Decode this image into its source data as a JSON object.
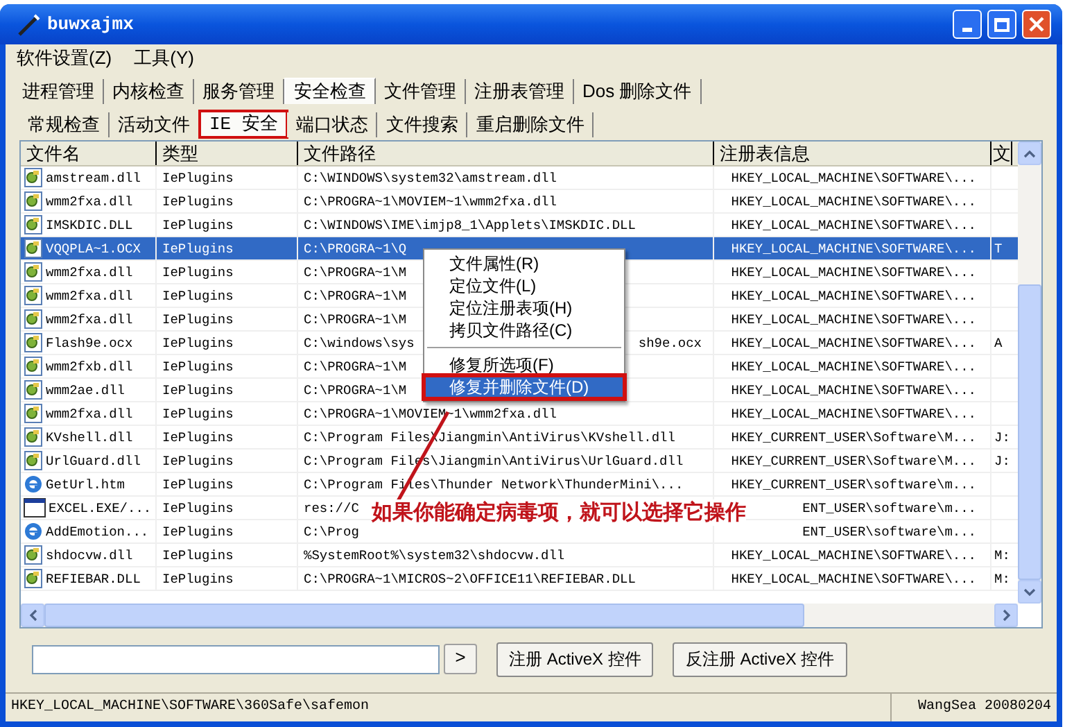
{
  "window": {
    "title": "buwxajmx"
  },
  "menu": [
    "软件设置(Z)",
    "工具(Y)"
  ],
  "tabs": [
    {
      "label": "进程管理",
      "selected": false
    },
    {
      "label": "内核检查",
      "selected": false
    },
    {
      "label": "服务管理",
      "selected": false
    },
    {
      "label": "安全检查",
      "selected": true
    },
    {
      "label": "文件管理",
      "selected": false
    },
    {
      "label": "注册表管理",
      "selected": false
    },
    {
      "label": "Dos 删除文件",
      "selected": false
    }
  ],
  "subtabs": [
    {
      "label": "常规检查",
      "selected": false,
      "highlighted": false
    },
    {
      "label": "活动文件",
      "selected": false,
      "highlighted": false
    },
    {
      "label": "IE 安全",
      "selected": true,
      "highlighted": true
    },
    {
      "label": "端口状态",
      "selected": false,
      "highlighted": false
    },
    {
      "label": "文件搜索",
      "selected": false,
      "highlighted": false
    },
    {
      "label": "重启删除文件",
      "selected": false,
      "highlighted": false
    }
  ],
  "table": {
    "columns": [
      "文件名",
      "类型",
      "文件路径",
      "注册表信息",
      "文"
    ],
    "rows": [
      {
        "kind": "dll",
        "selected": false,
        "name": "amstream.dll",
        "type": "IePlugins",
        "path": "C:\\WINDOWS\\system32\\amstream.dll",
        "registry": "HKEY_LOCAL_MACHINE\\SOFTWARE\\..."
      },
      {
        "kind": "dll",
        "selected": false,
        "name": "wmm2fxa.dll",
        "type": "IePlugins",
        "path": "C:\\PROGRA~1\\MOVIEM~1\\wmm2fxa.dll",
        "registry": "HKEY_LOCAL_MACHINE\\SOFTWARE\\..."
      },
      {
        "kind": "dll",
        "selected": false,
        "name": "IMSKDIC.DLL",
        "type": "IePlugins",
        "path": "C:\\WINDOWS\\IME\\imjp8_1\\Applets\\IMSKDIC.DLL",
        "registry": "HKEY_LOCAL_MACHINE\\SOFTWARE\\..."
      },
      {
        "kind": "dll",
        "selected": true,
        "name": "VQQPLA~1.OCX",
        "type": "IePlugins",
        "path": "C:\\PROGRA~1\\Q",
        "registry": "HKEY_LOCAL_MACHINE\\SOFTWARE\\...",
        "extra": "T"
      },
      {
        "kind": "dll",
        "selected": false,
        "name": "wmm2fxa.dll",
        "type": "IePlugins",
        "path": "C:\\PROGRA~1\\M",
        "registry": "HKEY_LOCAL_MACHINE\\SOFTWARE\\..."
      },
      {
        "kind": "dll",
        "selected": false,
        "name": "wmm2fxa.dll",
        "type": "IePlugins",
        "path": "C:\\PROGRA~1\\M",
        "registry": "HKEY_LOCAL_MACHINE\\SOFTWARE\\..."
      },
      {
        "kind": "dll",
        "selected": false,
        "name": "wmm2fxa.dll",
        "type": "IePlugins",
        "path": "C:\\PROGRA~1\\M",
        "registry": "HKEY_LOCAL_MACHINE\\SOFTWARE\\..."
      },
      {
        "kind": "dll",
        "selected": false,
        "name": "Flash9e.ocx",
        "type": "IePlugins",
        "path": "C:\\windows\\sys",
        "path_tail": "sh9e.ocx",
        "registry": "HKEY_LOCAL_MACHINE\\SOFTWARE\\...",
        "extra": "A"
      },
      {
        "kind": "dll",
        "selected": false,
        "name": "wmm2fxb.dll",
        "type": "IePlugins",
        "path": "C:\\PROGRA~1\\M",
        "registry": "HKEY_LOCAL_MACHINE\\SOFTWARE\\..."
      },
      {
        "kind": "dll",
        "selected": false,
        "name": "wmm2ae.dll",
        "type": "IePlugins",
        "path": "C:\\PROGRA~1\\M",
        "registry": "HKEY_LOCAL_MACHINE\\SOFTWARE\\..."
      },
      {
        "kind": "dll",
        "selected": false,
        "name": "wmm2fxa.dll",
        "type": "IePlugins",
        "path": "C:\\PROGRA~1\\MOVIEM~1\\wmm2fxa.dll",
        "registry": "HKEY_LOCAL_MACHINE\\SOFTWARE\\..."
      },
      {
        "kind": "dll",
        "selected": false,
        "name": "KVshell.dll",
        "type": "IePlugins",
        "path": "C:\\Program Files\\Jiangmin\\AntiVirus\\KVshell.dll",
        "registry": "HKEY_CURRENT_USER\\Software\\M...",
        "extra": "J:"
      },
      {
        "kind": "dll",
        "selected": false,
        "name": "UrlGuard.dll",
        "type": "IePlugins",
        "path": "C:\\Program Files\\Jiangmin\\AntiVirus\\UrlGuard.dll",
        "registry": "HKEY_CURRENT_USER\\Software\\M...",
        "extra": "J:"
      },
      {
        "kind": "ie",
        "selected": false,
        "name": "GetUrl.htm",
        "type": "IePlugins",
        "path": "C:\\Program Files\\Thunder Network\\ThunderMini\\...",
        "registry": "HKEY_CURRENT_USER\\software\\m..."
      },
      {
        "kind": "window",
        "selected": false,
        "name": "EXCEL.EXE/...",
        "type": "IePlugins",
        "path": "res://C",
        "registry": "ENT_USER\\software\\m..."
      },
      {
        "kind": "ie",
        "selected": false,
        "name": "AddEmotion...",
        "type": "IePlugins",
        "path": "C:\\Prog",
        "registry": "ENT_USER\\software\\m..."
      },
      {
        "kind": "dll",
        "selected": false,
        "name": "shdocvw.dll",
        "type": "IePlugins",
        "path": "%SystemRoot%\\system32\\shdocvw.dll",
        "registry": "HKEY_LOCAL_MACHINE\\SOFTWARE\\...",
        "extra": "M:"
      },
      {
        "kind": "dll",
        "selected": false,
        "name": "REFIEBAR.DLL",
        "type": "IePlugins",
        "path": "C:\\PROGRA~1\\MICROS~2\\OFFICE11\\REFIEBAR.DLL",
        "registry": "HKEY_LOCAL_MACHINE\\SOFTWARE\\...",
        "extra": "M:"
      }
    ]
  },
  "context_menu": [
    {
      "kind": "item",
      "label": "文件属性(R)",
      "selected": false,
      "highlighted": false
    },
    {
      "kind": "item",
      "label": "定位文件(L)",
      "selected": false,
      "highlighted": false
    },
    {
      "kind": "item",
      "label": "定位注册表项(H)",
      "selected": false,
      "highlighted": false
    },
    {
      "kind": "item",
      "label": "拷贝文件路径(C)",
      "selected": false,
      "highlighted": false
    },
    {
      "kind": "separator"
    },
    {
      "kind": "item",
      "label": "修复所选项(F)",
      "selected": false,
      "highlighted": false
    },
    {
      "kind": "item",
      "label": "修复并删除文件(D)",
      "selected": true,
      "highlighted": true
    }
  ],
  "annotation": {
    "text": "如果你能确定病毒项，就可以选择它操作"
  },
  "go_button": ">",
  "buttons": [
    "注册 ActiveX 控件",
    "反注册 ActiveX 控件"
  ],
  "status_bar": {
    "path": "HKEY_LOCAL_MACHINE\\SOFTWARE\\360Safe\\safemon",
    "author": "WangSea 20080204"
  }
}
